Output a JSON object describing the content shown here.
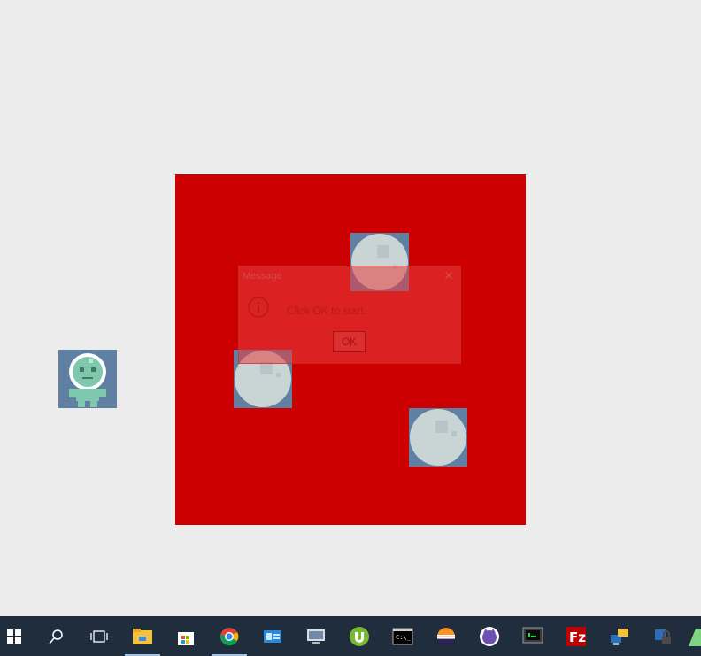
{
  "dialog": {
    "title": "Message",
    "message": "Click OK to start.",
    "ok_label": "OK"
  },
  "colors": {
    "background": "#ececec",
    "board": "#cc0000",
    "tile": "#5f7fa3",
    "asteroid": "#c9d5d5",
    "astronaut": "#7fc8ad",
    "taskbar": "#1f2d3c"
  },
  "taskbar": {
    "items": [
      {
        "icon": "windows-start-icon"
      },
      {
        "icon": "search-icon"
      },
      {
        "icon": "task-view-icon"
      },
      {
        "icon": "file-explorer-icon"
      },
      {
        "icon": "store-icon"
      },
      {
        "icon": "chrome-icon"
      },
      {
        "icon": "contacts-icon"
      },
      {
        "icon": "remote-desktop-icon"
      },
      {
        "icon": "utorrent-icon"
      },
      {
        "icon": "command-prompt-icon"
      },
      {
        "icon": "eclipse-icon"
      },
      {
        "icon": "cat-app-icon"
      },
      {
        "icon": "terminal-monitor-icon"
      },
      {
        "icon": "filezilla-icon"
      },
      {
        "icon": "network-tool-icon"
      },
      {
        "icon": "lock-tool-icon"
      }
    ]
  }
}
